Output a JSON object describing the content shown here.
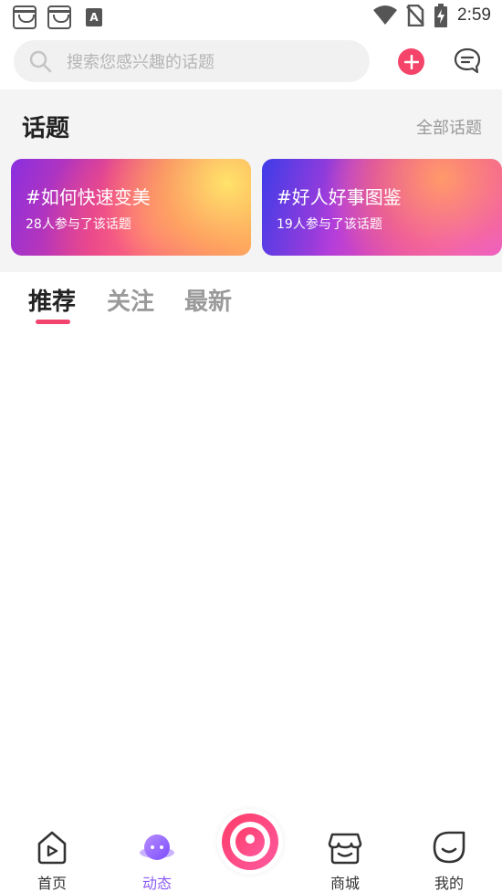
{
  "status_bar": {
    "time": "2:59"
  },
  "search": {
    "placeholder": "搜索您感兴趣的话题"
  },
  "topics": {
    "title": "话题",
    "all_label": "全部话题",
    "cards": [
      {
        "title": "#如何快速变美",
        "subtitle": "28人参与了该话题"
      },
      {
        "title": "#好人好事图鉴",
        "subtitle": "19人参与了该话题"
      }
    ]
  },
  "feed_tabs": [
    {
      "label": "推荐",
      "active": true
    },
    {
      "label": "关注",
      "active": false
    },
    {
      "label": "最新",
      "active": false
    }
  ],
  "bottom_nav": [
    {
      "label": "首页",
      "icon": "home-play-icon",
      "active": false
    },
    {
      "label": "动态",
      "icon": "planet-icon",
      "active": true
    },
    {
      "label": "",
      "icon": "camera-record-icon",
      "active": false
    },
    {
      "label": "商城",
      "icon": "store-icon",
      "active": false
    },
    {
      "label": "我的",
      "icon": "profile-face-icon",
      "active": false
    }
  ],
  "colors": {
    "accent": "#f2446e",
    "nav_active": "#8b5cf6",
    "add_button": "#f44469"
  }
}
